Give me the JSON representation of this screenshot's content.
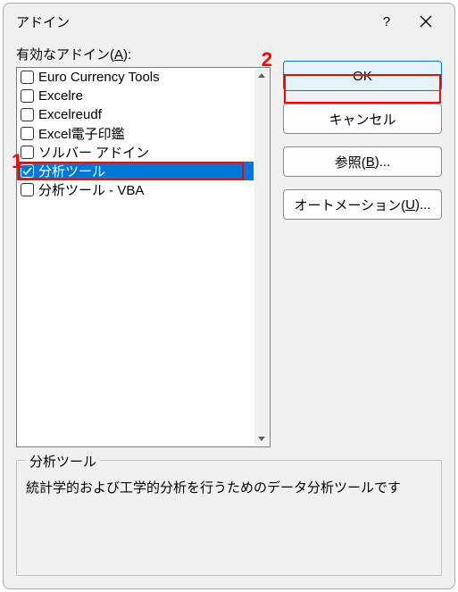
{
  "titlebar": {
    "title": "アドイン",
    "help_aria": "help",
    "close_aria": "close"
  },
  "addins": {
    "label_prefix": "有効なアドイン(",
    "label_accel": "A",
    "label_suffix": "):",
    "items": [
      {
        "label": "Euro Currency Tools",
        "checked": false,
        "selected": false
      },
      {
        "label": "Excelre",
        "checked": false,
        "selected": false
      },
      {
        "label": "Excelreudf",
        "checked": false,
        "selected": false
      },
      {
        "label": "Excel電子印鑑",
        "checked": false,
        "selected": false
      },
      {
        "label": "ソルバー アドイン",
        "checked": false,
        "selected": false
      },
      {
        "label": "分析ツール",
        "checked": true,
        "selected": true
      },
      {
        "label": "分析ツール - VBA",
        "checked": false,
        "selected": false
      }
    ]
  },
  "buttons": {
    "ok": "OK",
    "cancel": "キャンセル",
    "browse_prefix": "参照(",
    "browse_accel": "B",
    "browse_suffix": ")...",
    "automation_prefix": "オートメーション(",
    "automation_accel": "U",
    "automation_suffix": ")..."
  },
  "description": {
    "title": "分析ツール",
    "text": "統計学的および工学的分析を行うためのデータ分析ツールです"
  },
  "annotations": {
    "n1": "1",
    "n2": "2"
  }
}
